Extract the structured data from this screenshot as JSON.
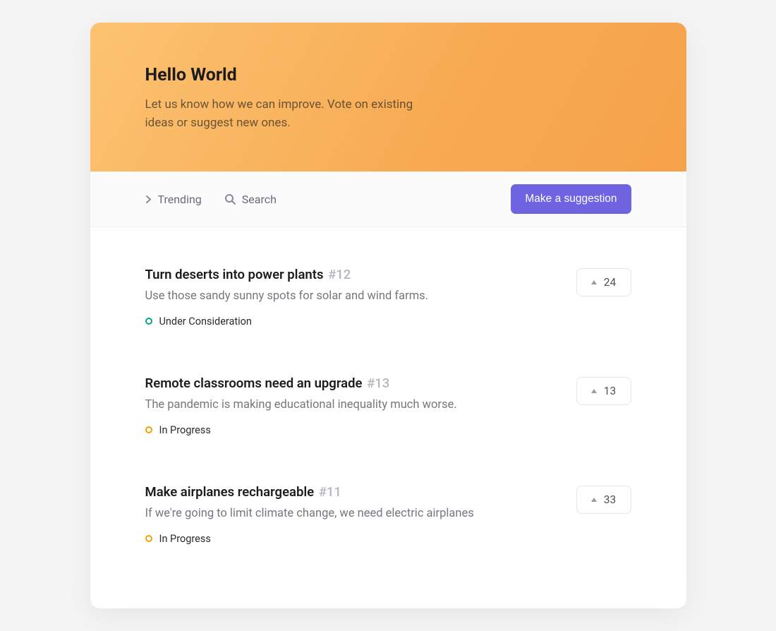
{
  "hero": {
    "title": "Hello World",
    "subtitle": "Let us know how we can improve. Vote on existing ideas or suggest new ones."
  },
  "toolbar": {
    "trending": "Trending",
    "search": "Search",
    "suggest": "Make a suggestion"
  },
  "statuses": {
    "under_consideration": "Under Consideration",
    "in_progress": "In Progress"
  },
  "ideas": [
    {
      "title": "Turn deserts into power plants",
      "hash": "#12",
      "desc": "Use those sandy sunny spots for solar and wind farms.",
      "status_key": "under_consideration",
      "status_color": "teal",
      "votes": "24"
    },
    {
      "title": "Remote classrooms need an upgrade",
      "hash": "#13",
      "desc": "The pandemic is making educational inequality much worse.",
      "status_key": "in_progress",
      "status_color": "orange",
      "votes": "13"
    },
    {
      "title": "Make airplanes rechargeable",
      "hash": "#11",
      "desc": "If we're going to limit climate change, we need electric airplanes",
      "status_key": "in_progress",
      "status_color": "orange",
      "votes": "33"
    }
  ]
}
